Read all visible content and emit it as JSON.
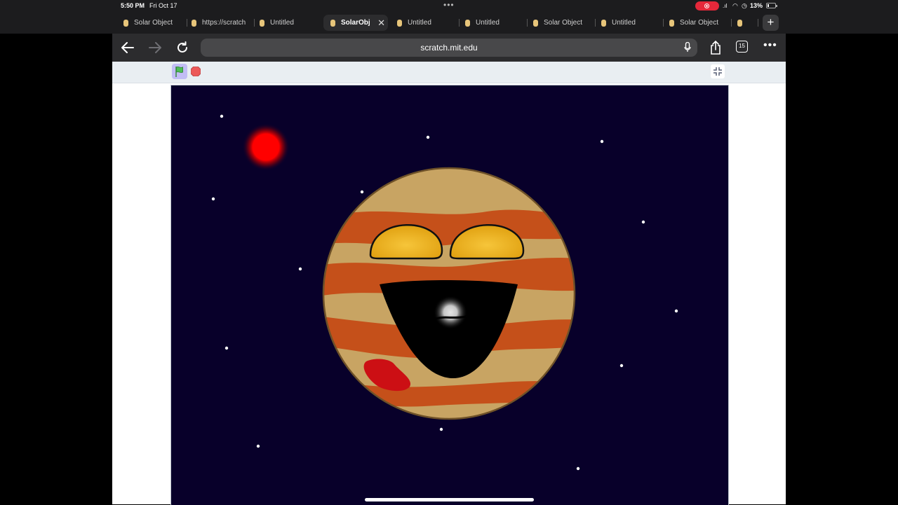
{
  "status_bar": {
    "time": "5:50 PM",
    "date": "Fri Oct 17",
    "battery": "13%"
  },
  "tabs": [
    {
      "label": "Solar Object",
      "active": false
    },
    {
      "label": "https://scratch",
      "active": false
    },
    {
      "label": "Untitled",
      "active": false
    },
    {
      "label": "SolarObj",
      "active": true
    },
    {
      "label": "Untitled",
      "active": false
    },
    {
      "label": "Untitled",
      "active": false
    },
    {
      "label": "Solar Object",
      "active": false
    },
    {
      "label": "Untitled",
      "active": false
    },
    {
      "label": "Solar Object",
      "active": false
    },
    {
      "label": "",
      "active": false
    }
  ],
  "toolbar": {
    "address": "scratch.mit.edu",
    "tab_count": "15"
  },
  "icons": {
    "back": "back-arrow-icon",
    "forward": "forward-arrow-icon",
    "reload": "reload-icon",
    "mic": "microphone-icon",
    "share": "share-icon",
    "tabs": "tabs-overview-icon",
    "more": "more-icon",
    "green_flag": "green-flag-icon",
    "stop": "stop-icon",
    "exit_fullscreen": "exit-fullscreen-icon"
  },
  "colors": {
    "stage_background": "#08002a",
    "planet_tan": "#c8a463",
    "planet_band": "#c5501a",
    "eye_gold": "#f0b21c",
    "red_sun": "#ff0000",
    "red_spot": "#cc0f14",
    "green_flag": "#4cbf56"
  }
}
